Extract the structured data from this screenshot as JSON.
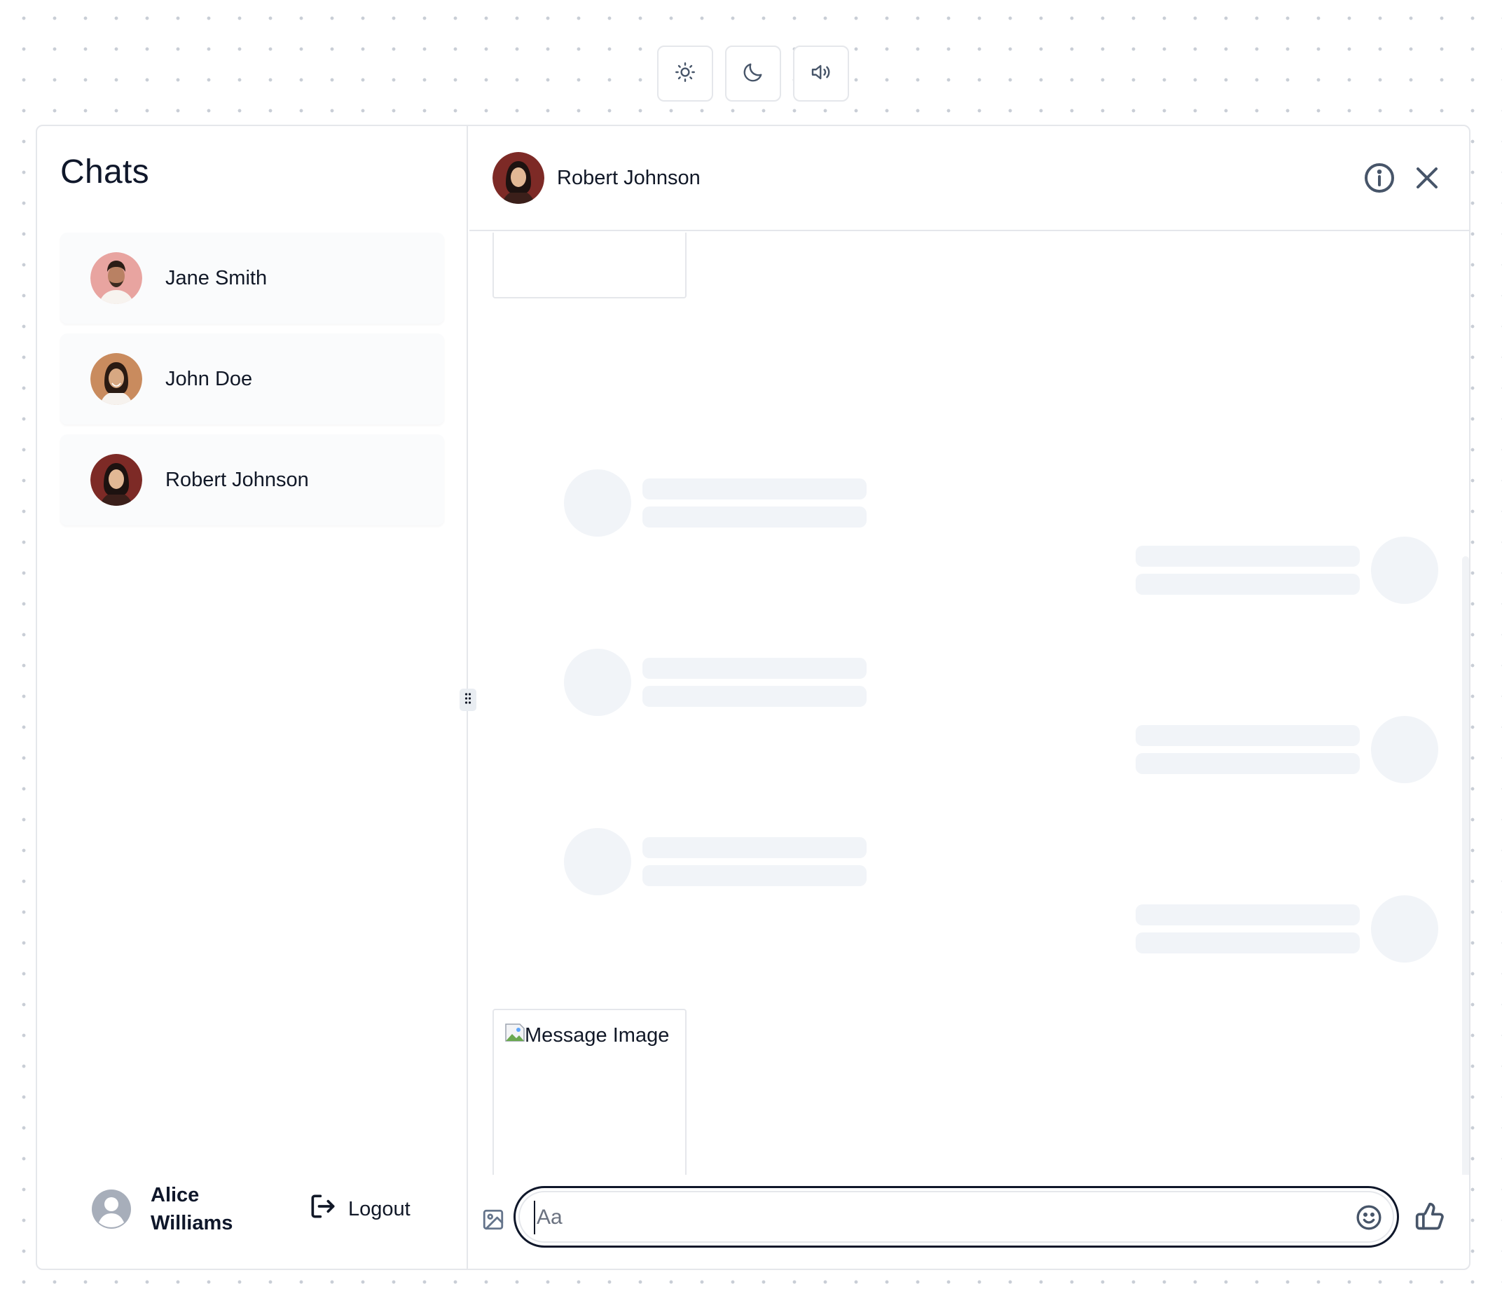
{
  "toolbar": {
    "buttons": [
      {
        "icon": "sun-icon"
      },
      {
        "icon": "moon-icon"
      },
      {
        "icon": "volume-icon"
      }
    ]
  },
  "sidebar": {
    "title": "Chats",
    "chats": [
      {
        "name": "Jane Smith",
        "avatar": "avatar-photo"
      },
      {
        "name": "John Doe",
        "avatar": "avatar-photo"
      },
      {
        "name": "Robert Johnson",
        "avatar": "avatar-photo"
      }
    ],
    "current_user": {
      "name": "Alice Williams",
      "avatar": "user-placeholder-icon"
    },
    "logout_label": "Logout"
  },
  "conversation": {
    "contact_name": "Robert Johnson",
    "header_icons": [
      "info-icon",
      "close-icon"
    ],
    "image_message_alt": "Message Image",
    "composer": {
      "placeholder": "Aa",
      "value": "",
      "icons": [
        "image-icon",
        "emoji-icon",
        "thumbs-up-icon"
      ]
    }
  },
  "colors": {
    "accent_border": "#0f172a",
    "skeleton": "#f1f4f8",
    "divider": "#e5e7eb",
    "icon": "#475569"
  }
}
